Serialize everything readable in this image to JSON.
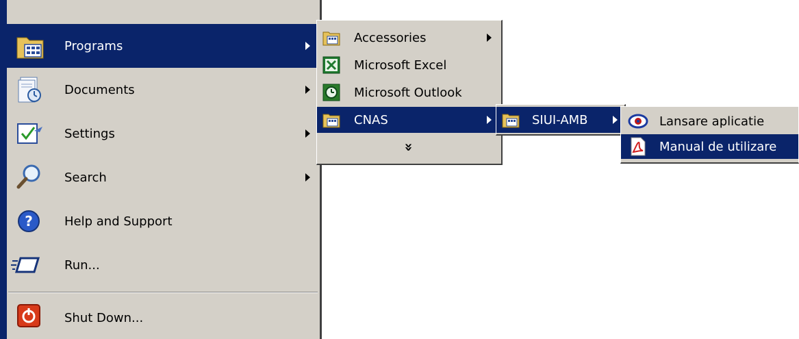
{
  "start_menu": {
    "items": [
      {
        "label": "Programs",
        "icon": "programs-folder-icon"
      },
      {
        "label": "Documents",
        "icon": "documents-icon"
      },
      {
        "label": "Settings",
        "icon": "settings-icon"
      },
      {
        "label": "Search",
        "icon": "search-icon"
      },
      {
        "label": "Help and Support",
        "icon": "help-icon"
      },
      {
        "label": "Run...",
        "icon": "run-icon"
      },
      {
        "label": "Shut Down...",
        "icon": "shutdown-icon"
      }
    ]
  },
  "programs_menu": {
    "items": [
      {
        "label": "Accessories",
        "icon": "folder-icon"
      },
      {
        "label": "Microsoft Excel",
        "icon": "excel-icon"
      },
      {
        "label": "Microsoft Outlook",
        "icon": "outlook-icon"
      },
      {
        "label": "CNAS",
        "icon": "folder-icon"
      }
    ],
    "expand_glyph": "»"
  },
  "cnas_menu": {
    "items": [
      {
        "label": "SIUI-AMB",
        "icon": "folder-icon"
      }
    ]
  },
  "siui_menu": {
    "items": [
      {
        "label": "Lansare aplicatie",
        "icon": "app-launch-icon"
      },
      {
        "label": "Manual de utilizare",
        "icon": "pdf-icon"
      }
    ]
  },
  "colors": {
    "menu_bg": "#d4d0c8",
    "highlight": "#0a246a",
    "sidebar": "#0a246a"
  }
}
